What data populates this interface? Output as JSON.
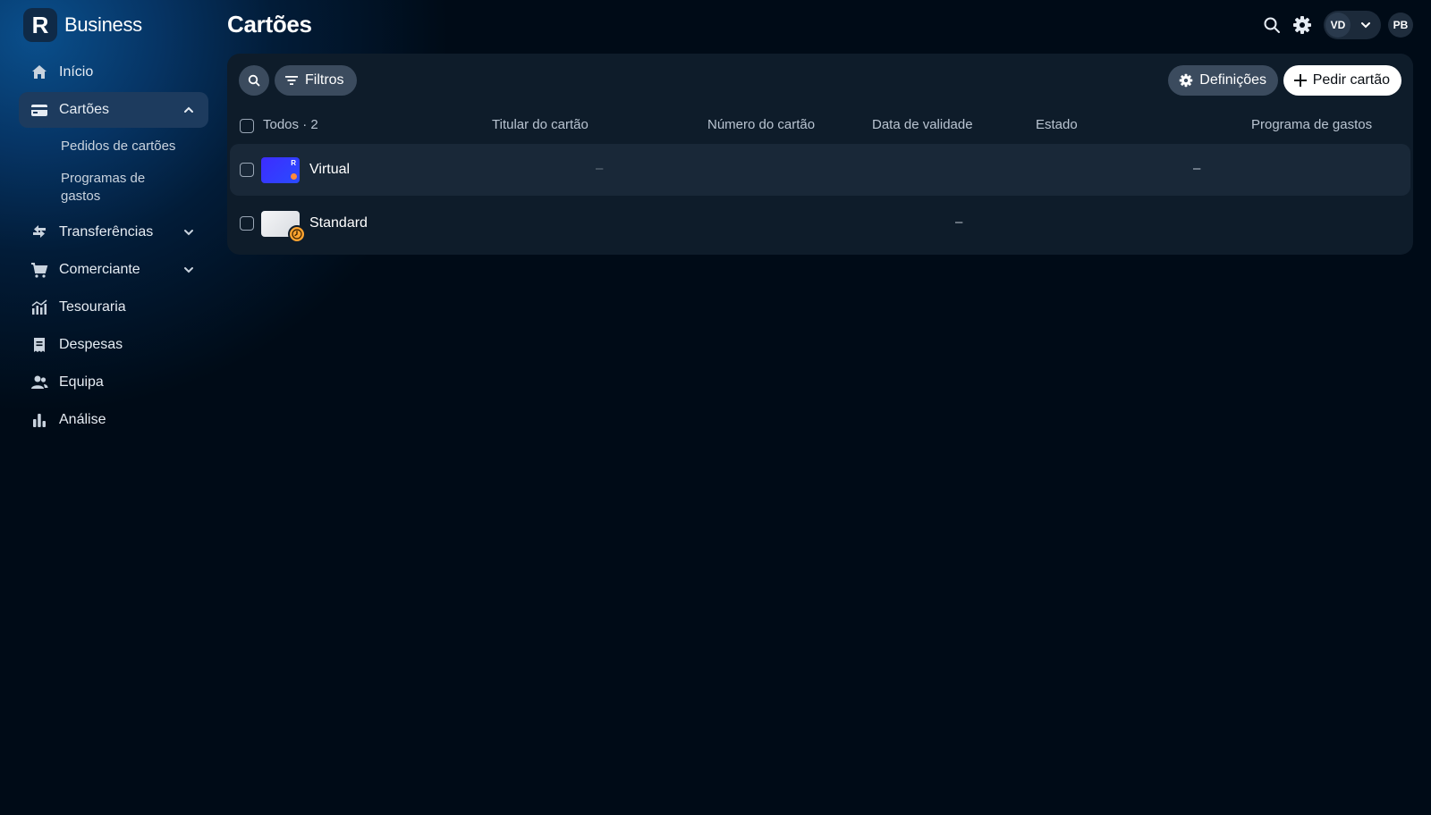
{
  "brand": {
    "logo_letter": "R",
    "name": "Business"
  },
  "sidebar": {
    "items": [
      {
        "label": "Início",
        "icon": "home-icon"
      },
      {
        "label": "Cartões",
        "icon": "card-icon",
        "active": true,
        "expanded": true,
        "subitems": [
          {
            "label": "Pedidos de cartões"
          },
          {
            "label": "Programas de gastos"
          }
        ]
      },
      {
        "label": "Transferências",
        "icon": "transfer-icon",
        "expandable": true
      },
      {
        "label": "Comerciante",
        "icon": "cart-icon",
        "expandable": true
      },
      {
        "label": "Tesouraria",
        "icon": "treasury-chart-icon"
      },
      {
        "label": "Despesas",
        "icon": "receipt-icon"
      },
      {
        "label": "Equipa",
        "icon": "team-icon"
      },
      {
        "label": "Análise",
        "icon": "bar-chart-icon"
      }
    ]
  },
  "header": {
    "title": "Cartões",
    "account_initials": "VD",
    "user_initials": "PB"
  },
  "toolbar": {
    "filters_label": "Filtros",
    "settings_label": "Definições",
    "order_label": "Pedir cartão"
  },
  "table": {
    "select_all_label": "Todos · 2",
    "columns": [
      "Titular do cartão",
      "Número do cartão",
      "Data de validade",
      "Estado",
      "Programa de gastos"
    ],
    "rows": [
      {
        "name": "Virtual",
        "holder": "–",
        "status": "–"
      },
      {
        "name": "Standard",
        "expiry": "–"
      }
    ]
  },
  "colors": {
    "background": "#000b17",
    "panel": "#0e1c2a",
    "active_nav": "#1d3b5e",
    "virtual_card": "#3d2cff",
    "pending_badge": "#ffa430"
  }
}
